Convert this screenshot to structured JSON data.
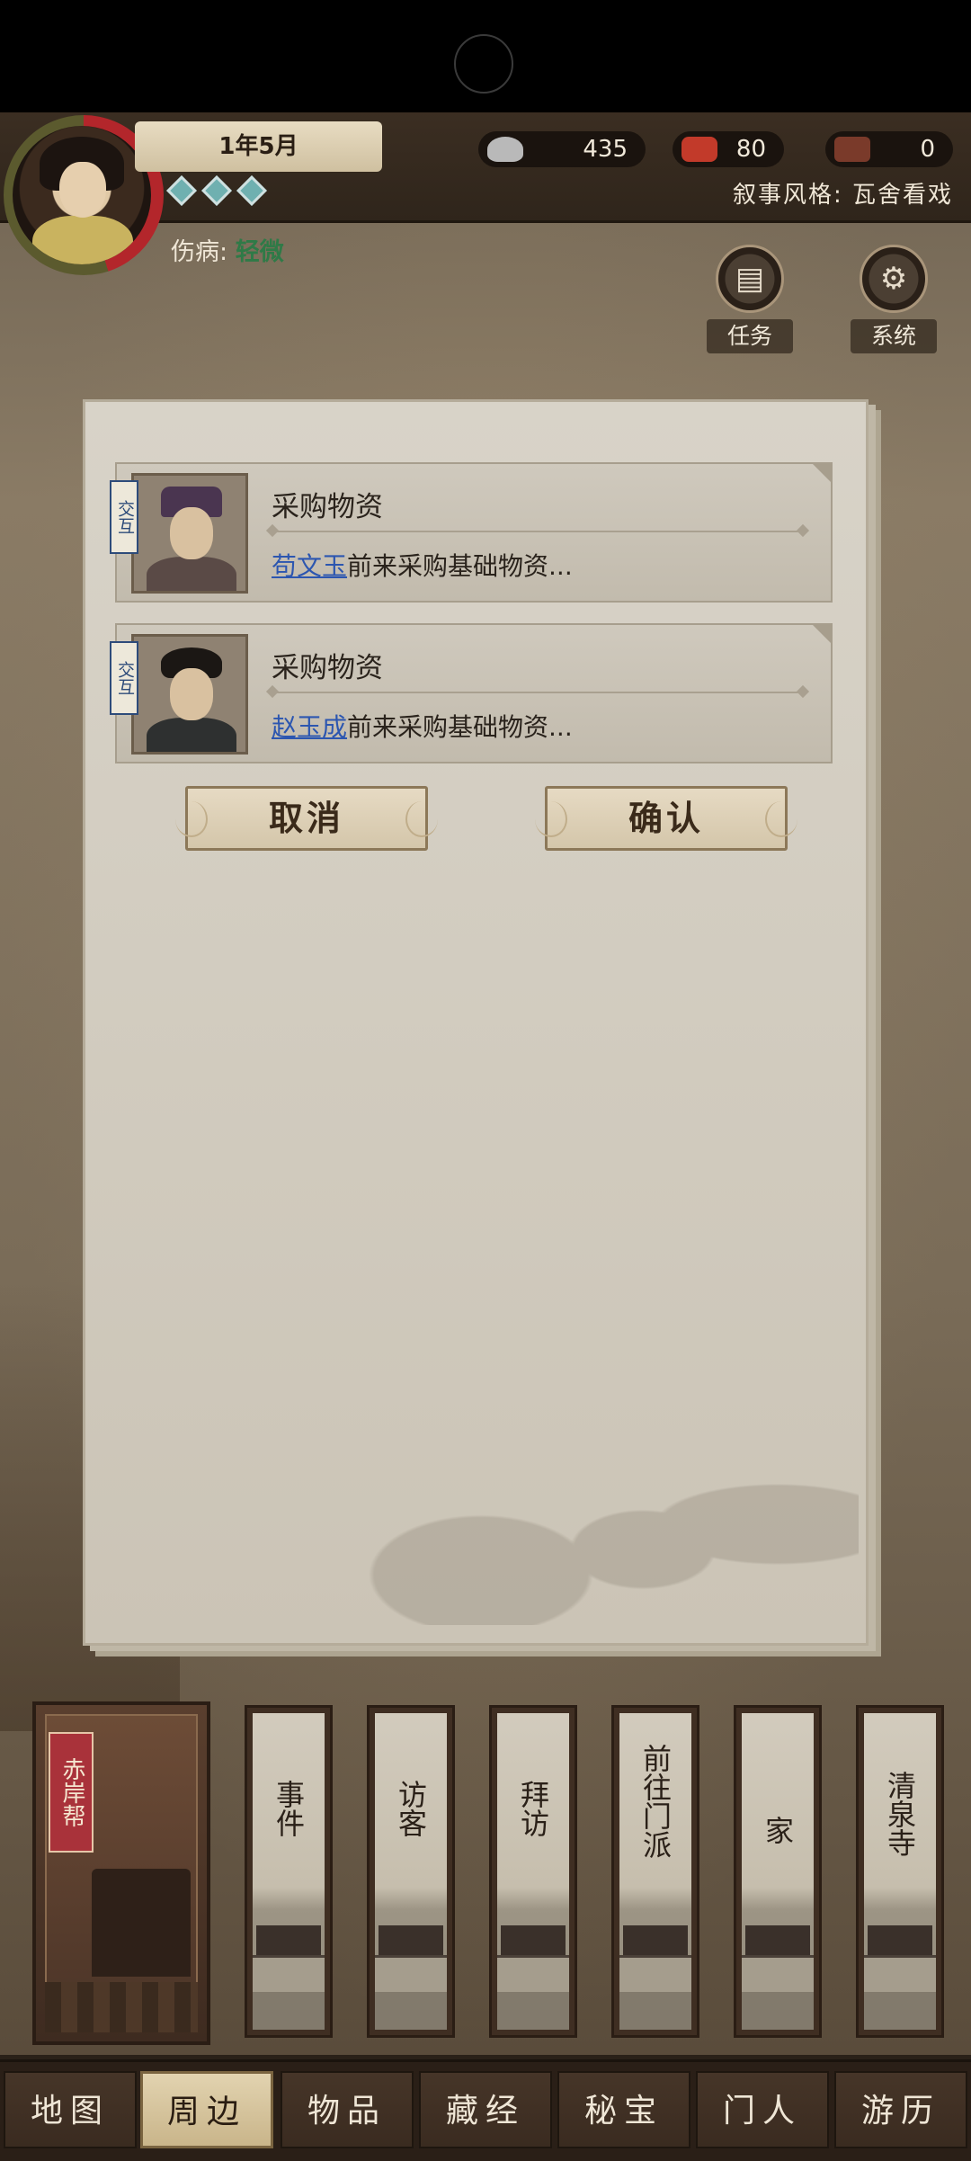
{
  "header": {
    "date": "1年5月",
    "injury_label": "伤病:",
    "injury_value": "轻微",
    "narrative_label": "叙事风格:",
    "narrative_value": "瓦舍看戏"
  },
  "resources": {
    "silver": "435",
    "flag": "80",
    "token": "0"
  },
  "quick_buttons": {
    "tasks": "任务",
    "system": "系统"
  },
  "dialog": {
    "events": [
      {
        "tag": "交互",
        "title": "采购物资",
        "name": "苟文玉",
        "desc": "前来采购基础物资..."
      },
      {
        "tag": "交互",
        "title": "采购物资",
        "name": "赵玉成",
        "desc": "前来采购基础物资..."
      }
    ],
    "cancel_label": "取消",
    "confirm_label": "确认"
  },
  "locations": {
    "current": "赤岸帮",
    "items": [
      "事件",
      "访客",
      "拜访",
      "前往门派",
      "家",
      "清泉寺"
    ]
  },
  "nav": {
    "tabs": [
      "地图",
      "周边",
      "物品",
      "藏经",
      "秘宝",
      "门人",
      "游历"
    ],
    "active": "周边"
  }
}
